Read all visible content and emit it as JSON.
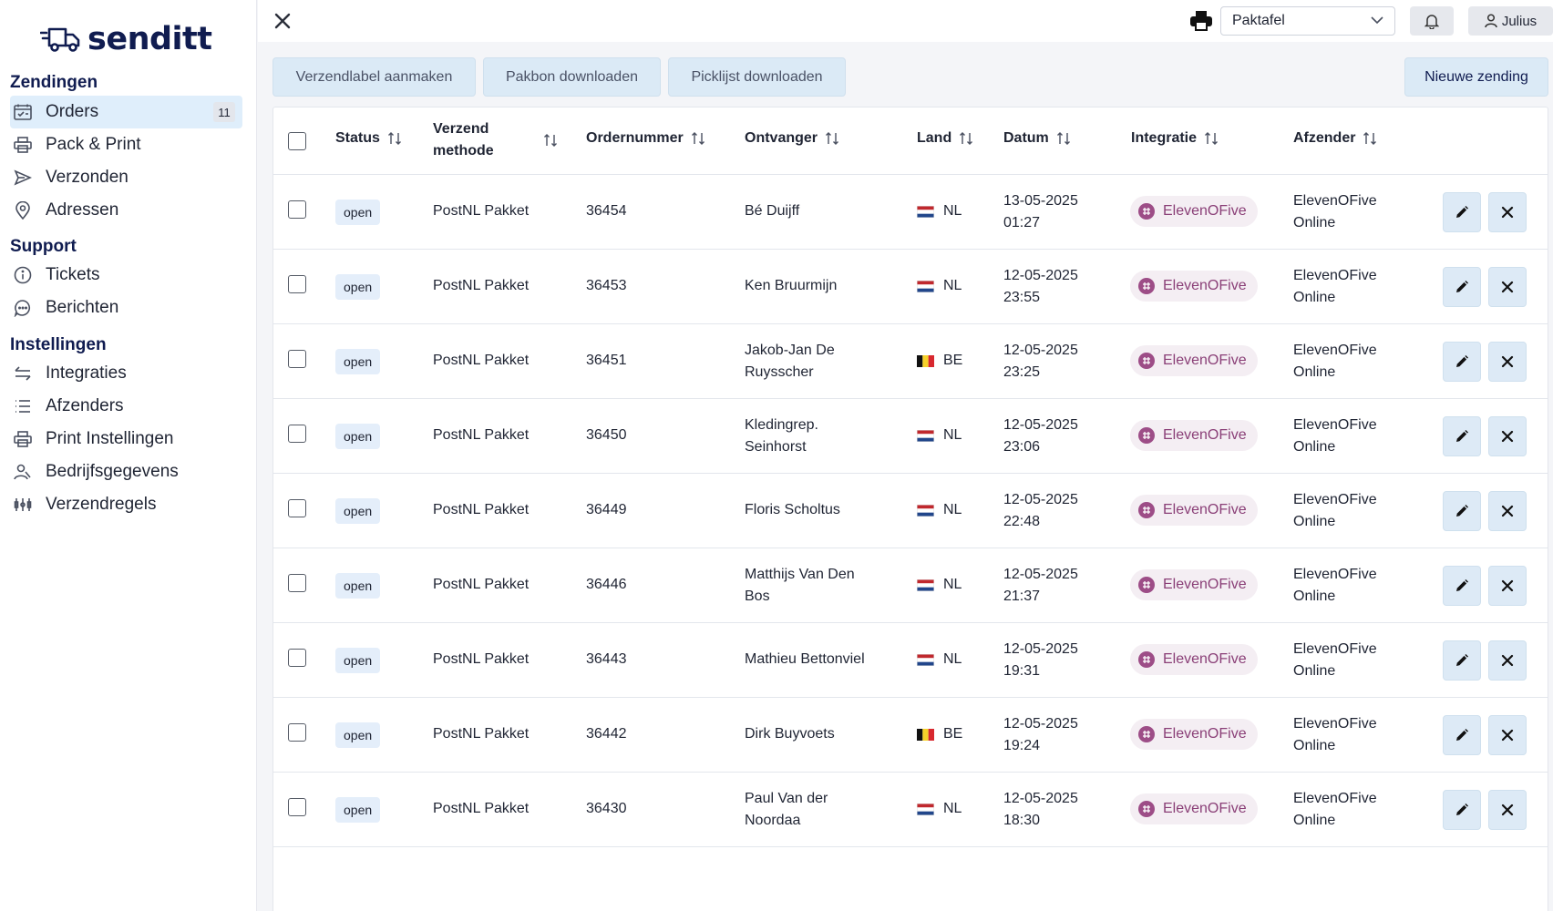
{
  "brand": {
    "name": "senditt"
  },
  "sidebar": {
    "sections": [
      {
        "title": "Zendingen"
      },
      {
        "title": "Support"
      },
      {
        "title": "Instellingen"
      }
    ],
    "items": [
      {
        "label": "Orders",
        "badge": "11"
      },
      {
        "label": "Pack & Print"
      },
      {
        "label": "Verzonden"
      },
      {
        "label": "Adressen"
      },
      {
        "label": "Tickets"
      },
      {
        "label": "Berichten"
      },
      {
        "label": "Integraties"
      },
      {
        "label": "Afzenders"
      },
      {
        "label": "Print Instellingen"
      },
      {
        "label": "Bedrijfsgegevens"
      },
      {
        "label": "Verzendregels"
      }
    ]
  },
  "topbar": {
    "printer_select": "Paktafel",
    "user_name": "Julius"
  },
  "toolbar": {
    "label_btn": "Verzendlabel aanmaken",
    "pakbon_btn": "Pakbon downloaden",
    "picklist_btn": "Picklijst downloaden",
    "new_btn": "Nieuwe zending"
  },
  "table": {
    "headers": {
      "status": "Status",
      "method_1": "Verzend",
      "method_2": "methode",
      "order": "Ordernummer",
      "recipient": "Ontvanger",
      "country": "Land",
      "date": "Datum",
      "integration": "Integratie",
      "sender": "Afzender"
    },
    "rows": [
      {
        "status": "open",
        "method": "PostNL Pakket",
        "order": "36454",
        "recipient_1": "Bé Duijff",
        "recipient_2": "",
        "country": "NL",
        "date": "13-05-2025",
        "time": "01:27",
        "integration": "ElevenOFive",
        "sender_1": "ElevenOFive",
        "sender_2": "Online"
      },
      {
        "status": "open",
        "method": "PostNL Pakket",
        "order": "36453",
        "recipient_1": "Ken Bruurmijn",
        "recipient_2": "",
        "country": "NL",
        "date": "12-05-2025",
        "time": "23:55",
        "integration": "ElevenOFive",
        "sender_1": "ElevenOFive",
        "sender_2": "Online"
      },
      {
        "status": "open",
        "method": "PostNL Pakket",
        "order": "36451",
        "recipient_1": "Jakob-Jan De",
        "recipient_2": "Ruysscher",
        "country": "BE",
        "date": "12-05-2025",
        "time": "23:25",
        "integration": "ElevenOFive",
        "sender_1": "ElevenOFive",
        "sender_2": "Online"
      },
      {
        "status": "open",
        "method": "PostNL Pakket",
        "order": "36450",
        "recipient_1": "Kledingrep.",
        "recipient_2": "Seinhorst",
        "country": "NL",
        "date": "12-05-2025",
        "time": "23:06",
        "integration": "ElevenOFive",
        "sender_1": "ElevenOFive",
        "sender_2": "Online"
      },
      {
        "status": "open",
        "method": "PostNL Pakket",
        "order": "36449",
        "recipient_1": "Floris Scholtus",
        "recipient_2": "",
        "country": "NL",
        "date": "12-05-2025",
        "time": "22:48",
        "integration": "ElevenOFive",
        "sender_1": "ElevenOFive",
        "sender_2": "Online"
      },
      {
        "status": "open",
        "method": "PostNL Pakket",
        "order": "36446",
        "recipient_1": "Matthijs Van Den",
        "recipient_2": "Bos",
        "country": "NL",
        "date": "12-05-2025",
        "time": "21:37",
        "integration": "ElevenOFive",
        "sender_1": "ElevenOFive",
        "sender_2": "Online"
      },
      {
        "status": "open",
        "method": "PostNL Pakket",
        "order": "36443",
        "recipient_1": "Mathieu Bettonviel",
        "recipient_2": "",
        "country": "NL",
        "date": "12-05-2025",
        "time": "19:31",
        "integration": "ElevenOFive",
        "sender_1": "ElevenOFive",
        "sender_2": "Online"
      },
      {
        "status": "open",
        "method": "PostNL Pakket",
        "order": "36442",
        "recipient_1": "Dirk Buyvoets",
        "recipient_2": "",
        "country": "BE",
        "date": "12-05-2025",
        "time": "19:24",
        "integration": "ElevenOFive",
        "sender_1": "ElevenOFive",
        "sender_2": "Online"
      },
      {
        "status": "open",
        "method": "PostNL Pakket",
        "order": "36430",
        "recipient_1": "Paul Van der",
        "recipient_2": "Noordaa",
        "country": "NL",
        "date": "12-05-2025",
        "time": "18:30",
        "integration": "ElevenOFive",
        "sender_1": "ElevenOFive",
        "sender_2": "Online"
      }
    ]
  },
  "colors": {
    "brand_navy": "#101c50",
    "active_nav": "#dfeefb",
    "button_bg": "#dbeaf6",
    "integration_text": "#8a3f77"
  },
  "icons": {
    "close": "close-icon",
    "printer": "printer-icon",
    "bell": "bell-icon",
    "user": "user-icon",
    "edit": "pencil-icon",
    "delete": "x-icon"
  }
}
